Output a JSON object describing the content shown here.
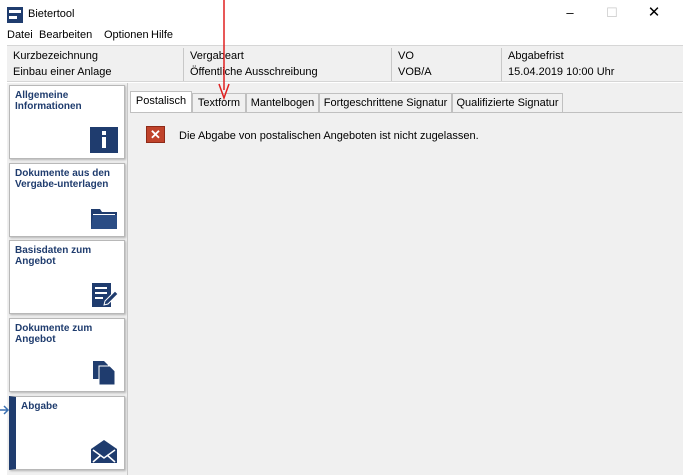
{
  "window": {
    "title": "Bietertool",
    "minimize": "–",
    "maximize": "☐",
    "close": "✕"
  },
  "menu": [
    "Datei",
    "Bearbeiten",
    "Optionen",
    "Hilfe"
  ],
  "info": [
    {
      "label": "Kurzbezeichnung",
      "value": "Einbau einer Anlage"
    },
    {
      "label": "Vergabeart",
      "value": "Öffentliche Ausschreibung"
    },
    {
      "label": "VO",
      "value": "VOB/A"
    },
    {
      "label": "Abgabefrist",
      "value": "15.04.2019 10:00 Uhr"
    }
  ],
  "sidebar": [
    {
      "label": "Allgemeine Informationen",
      "icon": "info-icon",
      "active": false
    },
    {
      "label": "Dokumente aus den Vergabe-unterlagen",
      "icon": "folder-icon",
      "active": false
    },
    {
      "label": "Basisdaten zum Angebot",
      "icon": "edit-form-icon",
      "active": false
    },
    {
      "label": "Dokumente zum Angebot",
      "icon": "documents-icon",
      "active": false
    },
    {
      "label": "Abgabe",
      "icon": "envelope-icon",
      "active": true
    }
  ],
  "tabs": [
    "Postalisch",
    "Textform",
    "Mantelbogen",
    "Fortgeschrittene Signatur",
    "Qualifizierte Signatur"
  ],
  "selected_tab": "Postalisch",
  "message": {
    "icon": "error-icon",
    "icon_glyph": "✕",
    "text": "Die Abgabe von postalischen Angeboten ist nicht zugelassen."
  },
  "colors": {
    "brand": "#1f3c6e",
    "error": "#c0432b",
    "annotation": "#e02020",
    "pointer": "#3a6fb0"
  }
}
